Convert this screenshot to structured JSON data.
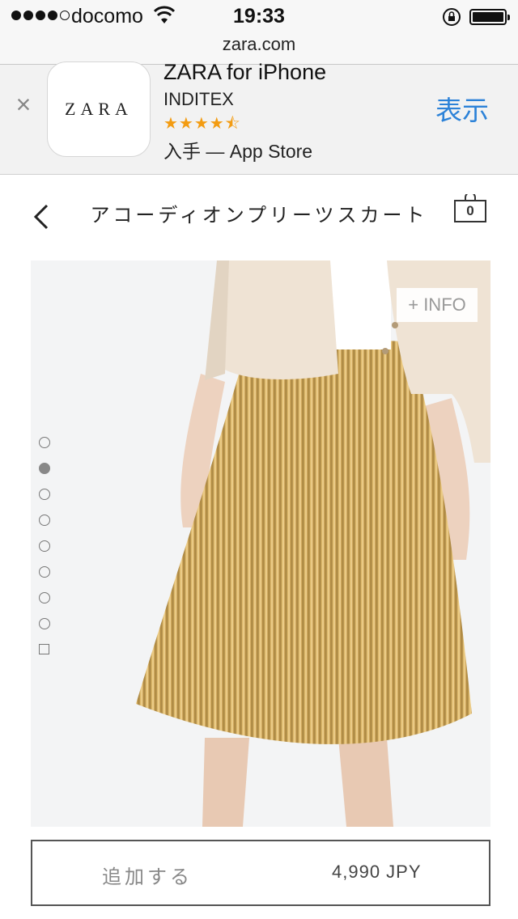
{
  "status_bar": {
    "carrier": "docomo",
    "time": "19:33",
    "signal_bars_filled": 4,
    "signal_bars_total": 5
  },
  "browser": {
    "url": "zara.com"
  },
  "app_banner": {
    "close_glyph": "×",
    "logo_text": "ZARA",
    "app_name": "ZARA for iPhone",
    "publisher": "INDITEX",
    "rating": 4.5,
    "stars_glyph": "★★★★⯪",
    "store_text": "入手 — App Store",
    "view_label": "表示",
    "accent_color": "#2c82d8"
  },
  "nav": {
    "title": "アコーディオンプリーツスカート",
    "bag_count": "0",
    "back_icon": "chevron-left-icon",
    "bag_icon": "shopping-bag-icon"
  },
  "product": {
    "info_label": "+ INFO",
    "image_count": 9,
    "active_image_index": 1,
    "add_label": "追加する",
    "price": "4,990 JPY"
  }
}
